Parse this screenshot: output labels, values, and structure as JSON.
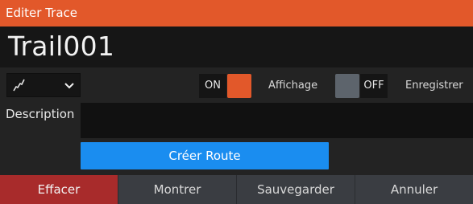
{
  "window": {
    "title": "Editer Trace"
  },
  "trail": {
    "name": "Trail001"
  },
  "controls": {
    "on_label": "ON",
    "display_label": "Affichage",
    "off_label": "OFF",
    "record_label": "Enregistrer",
    "style_icon": "trail-line-icon",
    "style_chevron": "chevron-down-icon"
  },
  "description": {
    "label": "Description",
    "value": ""
  },
  "actions": {
    "create_route": "Créer Route",
    "buttons": [
      {
        "label": "Effacer",
        "style": "danger"
      },
      {
        "label": "Montrer"
      },
      {
        "label": "Sauvegarder"
      },
      {
        "label": "Annuler"
      }
    ]
  },
  "colors": {
    "titlebar": "#e2582a",
    "toggle_on": "#e2582a",
    "toggle_off": "#5d646c",
    "primary_button": "#1a8df0",
    "danger_button": "#a82b2b",
    "background": "#232323"
  }
}
